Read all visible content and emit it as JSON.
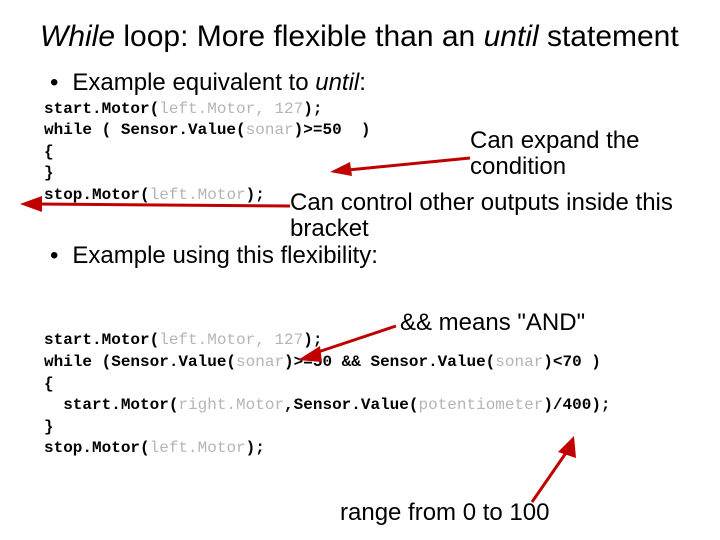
{
  "title": {
    "part1": "While",
    "part2": " loop: More flexible than an ",
    "part3": "until",
    "part4": " statement"
  },
  "bullet1": {
    "prefix": "Example equivalent to ",
    "until": "until",
    "suffix": ":"
  },
  "code1": {
    "l1a": "start.Motor(",
    "l1b": "left.Motor, 127",
    "l1c": ");",
    "l2a": "while ( Sensor.Value(",
    "l2b": "sonar",
    "l2c": ")>=50  )",
    "l3": "{",
    "l4": "}",
    "l5a": "stop.Motor(",
    "l5b": "left.Motor",
    "l5c": ");"
  },
  "anno1": "Can expand the condition",
  "anno2": "Can control other outputs inside this bracket",
  "bullet2": "Example using this flexibility:",
  "anno3": "&& means \"AND\"",
  "code2": {
    "l1a": "start.Motor(",
    "l1b": "left.Motor, 127",
    "l1c": ");",
    "l2a": "while (Sensor.Value(",
    "l2b": "sonar",
    "l2c": ")>=50 && Sensor.Value(",
    "l2d": "sonar",
    "l2e": ")<70 )",
    "l3": "{",
    "l4a": "  start.Motor(",
    "l4b": "right.Motor",
    "l4c": ",",
    "l4d": "Sensor.Value(",
    "l4e": "potentiometer",
    "l4f": ")/400);",
    "l5": "}",
    "l6a": "stop.Motor(",
    "l6b": "left.Motor",
    "l6c": ");"
  },
  "anno4": "range from 0 to 100"
}
